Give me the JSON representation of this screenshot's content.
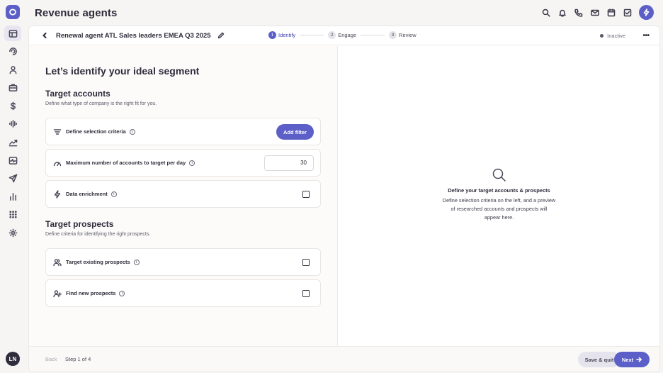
{
  "app": {
    "title": "Revenue agents",
    "accent_color": "#5b5fc7"
  },
  "user": {
    "initials": "LN"
  },
  "rail": {
    "items": [
      {
        "name": "layout-icon",
        "active": true
      },
      {
        "name": "spiral-icon"
      },
      {
        "name": "person-icon"
      },
      {
        "name": "briefcase-icon"
      },
      {
        "name": "dollar-icon"
      },
      {
        "name": "waveform-icon"
      },
      {
        "name": "trend-chart-icon"
      },
      {
        "name": "pulse-monitor-icon"
      },
      {
        "name": "send-icon"
      },
      {
        "name": "bar-chart-icon"
      },
      {
        "name": "grid-apps-icon"
      },
      {
        "name": "settings-gear-icon"
      }
    ]
  },
  "topbar": {
    "actions": [
      "search-icon",
      "bell-icon",
      "phone-icon",
      "mail-icon",
      "calendar-icon",
      "tasks-icon",
      "bolt-icon"
    ]
  },
  "subheader": {
    "agent_name": "Renewal agent ATL Sales leaders EMEA Q3 2025",
    "steps": [
      {
        "num": "1",
        "label": "Identify",
        "active": true
      },
      {
        "num": "2",
        "label": "Engage"
      },
      {
        "num": "3",
        "label": "Review"
      }
    ],
    "status": "Inactive",
    "more": "•••"
  },
  "main": {
    "heading": "Let’s identify your ideal segment",
    "target_accounts": {
      "title": "Target accounts",
      "description": "Define what type of company is the right fit for you.",
      "rows": {
        "criteria": {
          "label": "Define selection criteria",
          "button": "Add filter"
        },
        "max_accounts": {
          "label": "Maximum number of accounts to target per day",
          "value": "30"
        },
        "enrichment": {
          "label": "Data enrichment",
          "checked": false
        }
      }
    },
    "target_prospects": {
      "title": "Target prospects",
      "description": "Define criteria for identifying the right prospects.",
      "rows": {
        "existing": {
          "label": "Target existing prospects",
          "checked": false
        },
        "new": {
          "label": "Find new prospects",
          "checked": false
        }
      }
    }
  },
  "preview": {
    "title": "Define your target accounts & prospects",
    "description": "Define selection criteria on the left, and a preview of researched accounts and prospects will appear here."
  },
  "footer": {
    "back": "Back",
    "step": "Step 1 of 4",
    "save": "Save & quit",
    "next": "Next"
  }
}
